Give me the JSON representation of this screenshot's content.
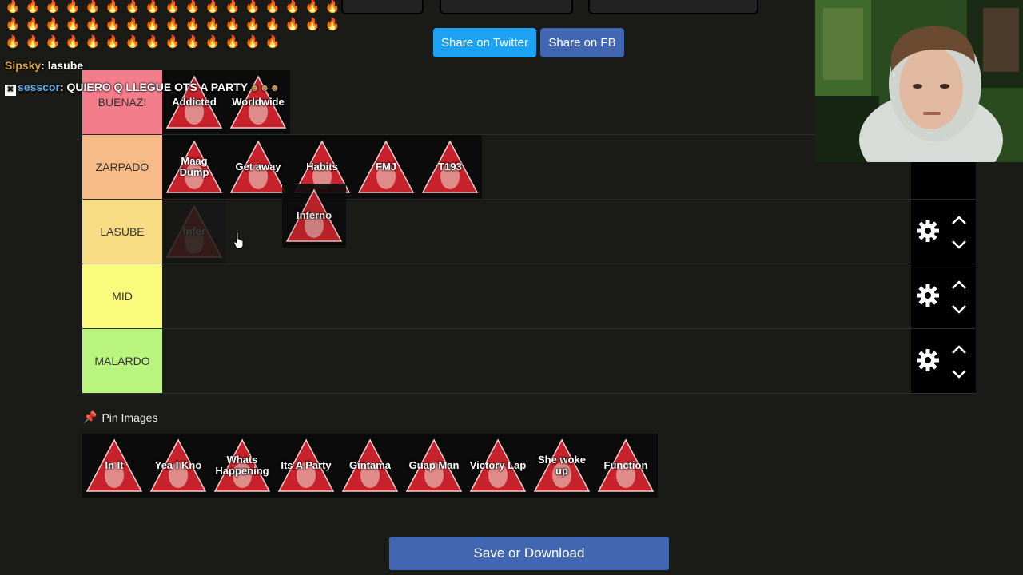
{
  "share": {
    "twitter_label": "Share on Twitter",
    "fb_label": "Share on FB"
  },
  "tiers": [
    {
      "label": "BUENAZI",
      "color": "#f47d8c",
      "items": [
        "Addicted",
        "Worldwide"
      ]
    },
    {
      "label": "ZARPADO",
      "color": "#f6bb86",
      "items": [
        "Maag Dump",
        "Get away",
        "Habits",
        "FMJ",
        "T193"
      ]
    },
    {
      "label": "LASUBE",
      "color": "#f8dc84",
      "items": [
        "Infer"
      ],
      "dragging": "Inferno"
    },
    {
      "label": "MID",
      "color": "#fafa7c",
      "items": []
    },
    {
      "label": "MALARDO",
      "color": "#b9f57e",
      "items": []
    }
  ],
  "chat": {
    "line1_user": "Sipsky",
    "line1_msg": "lasube",
    "line2_user": "sesscor",
    "line2_msg": "QUIERO Q LLEGUE OTS A PARTY",
    "fire_count": 48,
    "fire_icon": "fire-emoji"
  },
  "pin": {
    "label": "Pin Images",
    "icon": "pushpin-icon"
  },
  "pool_items": [
    "In It",
    "Yea I Kno",
    "Whats Happening",
    "Its A Party",
    "Gintama",
    "Guap Man",
    "Victory Lap",
    "She woke up",
    "Function"
  ],
  "save_label": "Save or Download",
  "colors": {
    "twitter": "#1da1f2",
    "facebook": "#4267b2",
    "tile_red": "#c8232c",
    "background": "#1a1a17"
  }
}
